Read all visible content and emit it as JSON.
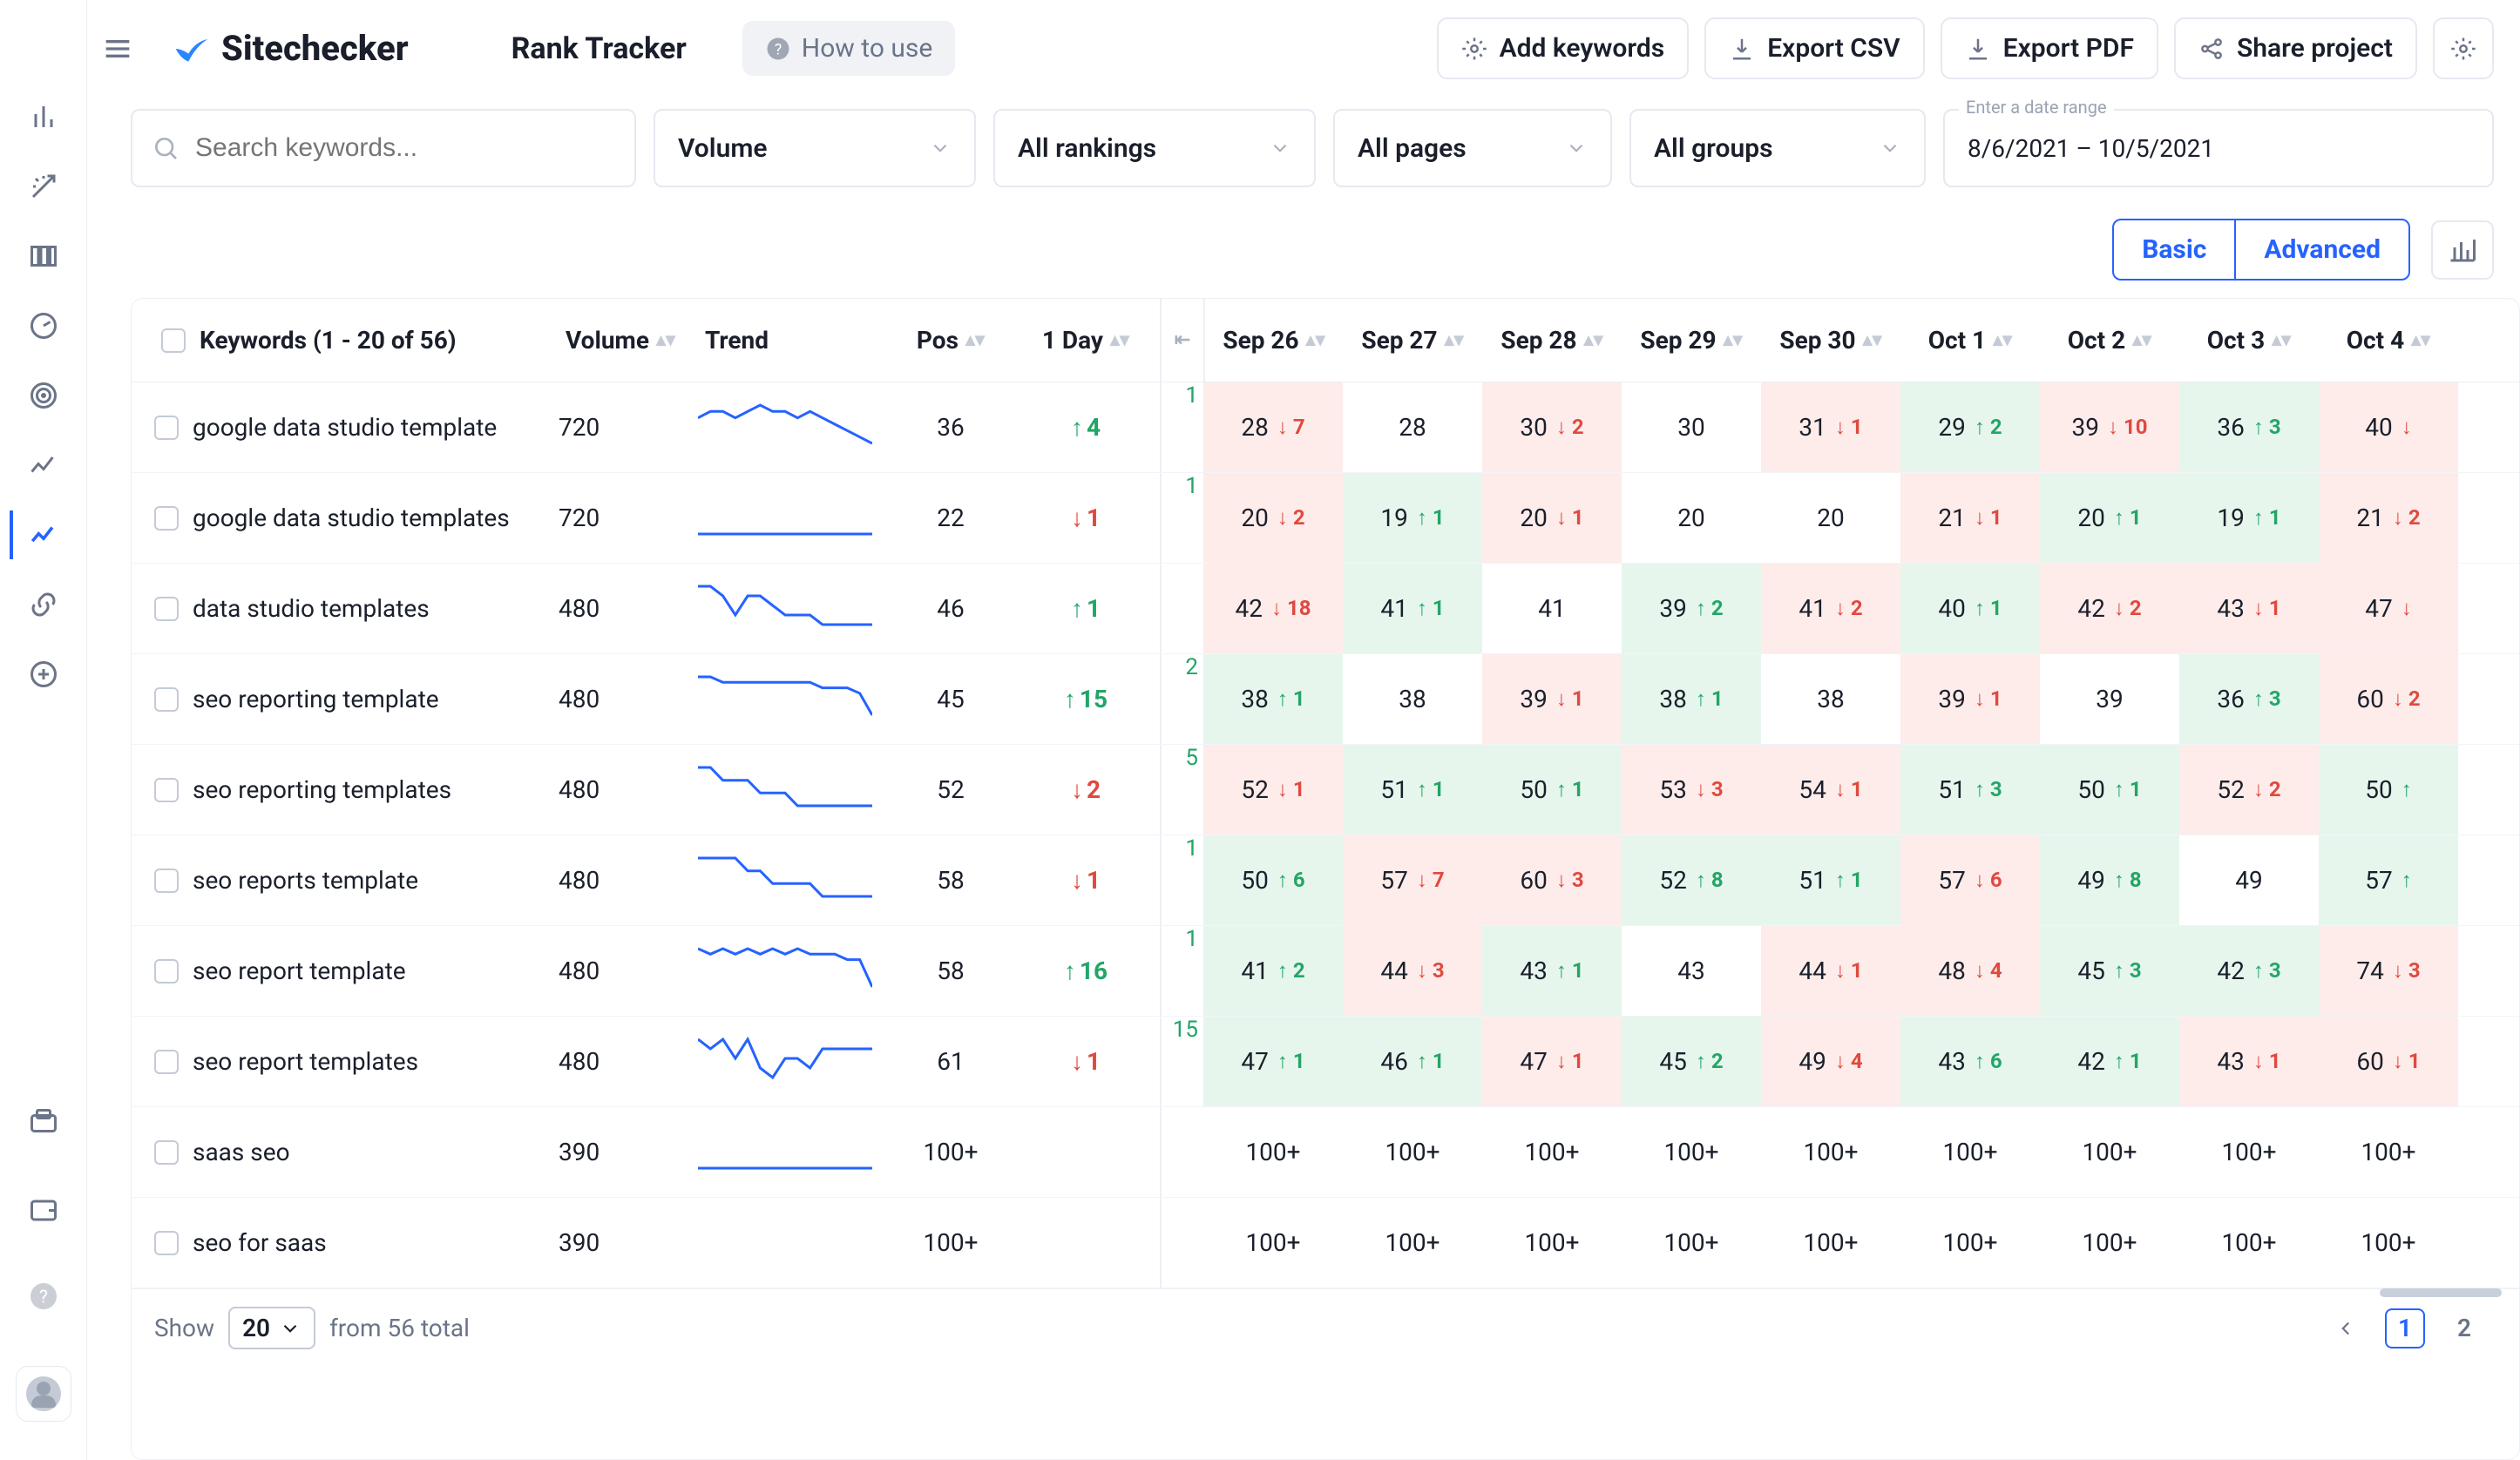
{
  "brand": {
    "name": "Sitechecker"
  },
  "page_title": "Rank Tracker",
  "how_to_use": "How to use",
  "header_buttons": {
    "add_keywords": "Add keywords",
    "export_csv": "Export CSV",
    "export_pdf": "Export PDF",
    "share_project": "Share project"
  },
  "filters": {
    "search_placeholder": "Search keywords...",
    "volume": "Volume",
    "rankings": "All rankings",
    "pages": "All pages",
    "groups": "All groups",
    "date_legend": "Enter a date range",
    "date_value": "8/6/2021 – 10/5/2021"
  },
  "mode_tabs": {
    "basic": "Basic",
    "advanced": "Advanced"
  },
  "columns": {
    "keywords_label": "Keywords (1 - 20 of 56)",
    "volume": "Volume",
    "trend": "Trend",
    "pos": "Pos",
    "one_day": "1 Day",
    "dates": [
      "Sep 26",
      "Sep 27",
      "Sep 28",
      "Sep 29",
      "Sep 30",
      "Oct 1",
      "Oct 2",
      "Oct 3",
      "Oct 4"
    ]
  },
  "rows": [
    {
      "keyword": "google data studio template",
      "volume": "720",
      "pos": "36",
      "one_day": {
        "dir": "up",
        "v": "4"
      },
      "spark": [
        8,
        9,
        9,
        8,
        9,
        10,
        9,
        9,
        8,
        9,
        8,
        7,
        6,
        5,
        4
      ],
      "edge": "1",
      "cells": [
        {
          "v": "28",
          "chg": {
            "dir": "down",
            "n": "7"
          }
        },
        {
          "v": "28"
        },
        {
          "v": "30",
          "chg": {
            "dir": "down",
            "n": "2"
          }
        },
        {
          "v": "30"
        },
        {
          "v": "31",
          "chg": {
            "dir": "down",
            "n": "1"
          }
        },
        {
          "v": "29",
          "chg": {
            "dir": "up",
            "n": "2"
          }
        },
        {
          "v": "39",
          "chg": {
            "dir": "down",
            "n": "10"
          }
        },
        {
          "v": "36",
          "chg": {
            "dir": "up",
            "n": "3"
          }
        },
        {
          "v": "40",
          "chg": {
            "dir": "down",
            "n": ""
          }
        }
      ]
    },
    {
      "keyword": "google data studio templates",
      "volume": "720",
      "pos": "22",
      "one_day": {
        "dir": "down",
        "v": "1"
      },
      "spark": [
        9,
        9,
        9,
        9,
        9,
        9,
        9,
        9,
        9,
        9,
        9,
        9,
        9,
        9,
        9
      ],
      "edge": "1",
      "cells": [
        {
          "v": "20",
          "chg": {
            "dir": "down",
            "n": "2"
          }
        },
        {
          "v": "19",
          "chg": {
            "dir": "up",
            "n": "1"
          }
        },
        {
          "v": "20",
          "chg": {
            "dir": "down",
            "n": "1"
          }
        },
        {
          "v": "20"
        },
        {
          "v": "20"
        },
        {
          "v": "21",
          "chg": {
            "dir": "down",
            "n": "1"
          }
        },
        {
          "v": "20",
          "chg": {
            "dir": "up",
            "n": "1"
          }
        },
        {
          "v": "19",
          "chg": {
            "dir": "up",
            "n": "1"
          }
        },
        {
          "v": "21",
          "chg": {
            "dir": "down",
            "n": "2"
          }
        }
      ]
    },
    {
      "keyword": "data studio templates",
      "volume": "480",
      "pos": "46",
      "one_day": {
        "dir": "up",
        "v": "1"
      },
      "spark": [
        9,
        9,
        8,
        6,
        8,
        8,
        7,
        6,
        6,
        6,
        5,
        5,
        5,
        5,
        5
      ],
      "edge": "",
      "cells": [
        {
          "v": "42",
          "chg": {
            "dir": "down",
            "n": "18"
          }
        },
        {
          "v": "41",
          "chg": {
            "dir": "up",
            "n": "1"
          }
        },
        {
          "v": "41"
        },
        {
          "v": "39",
          "chg": {
            "dir": "up",
            "n": "2"
          }
        },
        {
          "v": "41",
          "chg": {
            "dir": "down",
            "n": "2"
          }
        },
        {
          "v": "40",
          "chg": {
            "dir": "up",
            "n": "1"
          }
        },
        {
          "v": "42",
          "chg": {
            "dir": "down",
            "n": "2"
          }
        },
        {
          "v": "43",
          "chg": {
            "dir": "down",
            "n": "1"
          }
        },
        {
          "v": "47",
          "chg": {
            "dir": "down",
            "n": ""
          }
        }
      ]
    },
    {
      "keyword": "seo reporting template",
      "volume": "480",
      "pos": "45",
      "one_day": {
        "dir": "up",
        "v": "15"
      },
      "spark": [
        9,
        9,
        8,
        8,
        8,
        8,
        8,
        8,
        8,
        8,
        7,
        7,
        7,
        6,
        2
      ],
      "edge": "2",
      "cells": [
        {
          "v": "38",
          "chg": {
            "dir": "up",
            "n": "1"
          }
        },
        {
          "v": "38"
        },
        {
          "v": "39",
          "chg": {
            "dir": "down",
            "n": "1"
          }
        },
        {
          "v": "38",
          "chg": {
            "dir": "up",
            "n": "1"
          }
        },
        {
          "v": "38"
        },
        {
          "v": "39",
          "chg": {
            "dir": "down",
            "n": "1"
          }
        },
        {
          "v": "39"
        },
        {
          "v": "36",
          "chg": {
            "dir": "up",
            "n": "3"
          }
        },
        {
          "v": "60",
          "chg": {
            "dir": "down",
            "n": "2"
          }
        }
      ]
    },
    {
      "keyword": "seo reporting templates",
      "volume": "480",
      "pos": "52",
      "one_day": {
        "dir": "down",
        "v": "2"
      },
      "spark": [
        9,
        9,
        8,
        8,
        8,
        7,
        7,
        7,
        6,
        6,
        6,
        6,
        6,
        6,
        6
      ],
      "edge": "5",
      "cells": [
        {
          "v": "52",
          "chg": {
            "dir": "down",
            "n": "1"
          }
        },
        {
          "v": "51",
          "chg": {
            "dir": "up",
            "n": "1"
          }
        },
        {
          "v": "50",
          "chg": {
            "dir": "up",
            "n": "1"
          }
        },
        {
          "v": "53",
          "chg": {
            "dir": "down",
            "n": "3"
          }
        },
        {
          "v": "54",
          "chg": {
            "dir": "down",
            "n": "1"
          }
        },
        {
          "v": "51",
          "chg": {
            "dir": "up",
            "n": "3"
          }
        },
        {
          "v": "50",
          "chg": {
            "dir": "up",
            "n": "1"
          }
        },
        {
          "v": "52",
          "chg": {
            "dir": "down",
            "n": "2"
          }
        },
        {
          "v": "50",
          "chg": {
            "dir": "up",
            "n": ""
          }
        }
      ]
    },
    {
      "keyword": "seo reports template",
      "volume": "480",
      "pos": "58",
      "one_day": {
        "dir": "down",
        "v": "1"
      },
      "spark": [
        8,
        8,
        8,
        8,
        7,
        7,
        6,
        6,
        6,
        6,
        5,
        5,
        5,
        5,
        5
      ],
      "edge": "1",
      "cells": [
        {
          "v": "50",
          "chg": {
            "dir": "up",
            "n": "6"
          }
        },
        {
          "v": "57",
          "chg": {
            "dir": "down",
            "n": "7"
          }
        },
        {
          "v": "60",
          "chg": {
            "dir": "down",
            "n": "3"
          }
        },
        {
          "v": "52",
          "chg": {
            "dir": "up",
            "n": "8"
          }
        },
        {
          "v": "51",
          "chg": {
            "dir": "up",
            "n": "1"
          }
        },
        {
          "v": "57",
          "chg": {
            "dir": "down",
            "n": "6"
          }
        },
        {
          "v": "49",
          "chg": {
            "dir": "up",
            "n": "8"
          }
        },
        {
          "v": "49"
        },
        {
          "v": "57",
          "chg": {
            "dir": "up",
            "n": ""
          }
        }
      ]
    },
    {
      "keyword": "seo report template",
      "volume": "480",
      "pos": "58",
      "one_day": {
        "dir": "up",
        "v": "16"
      },
      "spark": [
        9,
        8,
        9,
        8,
        9,
        8,
        9,
        8,
        9,
        8,
        8,
        8,
        7,
        7,
        2
      ],
      "edge": "1",
      "cells": [
        {
          "v": "41",
          "chg": {
            "dir": "up",
            "n": "2"
          }
        },
        {
          "v": "44",
          "chg": {
            "dir": "down",
            "n": "3"
          }
        },
        {
          "v": "43",
          "chg": {
            "dir": "up",
            "n": "1"
          }
        },
        {
          "v": "43"
        },
        {
          "v": "44",
          "chg": {
            "dir": "down",
            "n": "1"
          }
        },
        {
          "v": "48",
          "chg": {
            "dir": "down",
            "n": "4"
          }
        },
        {
          "v": "45",
          "chg": {
            "dir": "up",
            "n": "3"
          }
        },
        {
          "v": "42",
          "chg": {
            "dir": "up",
            "n": "3"
          }
        },
        {
          "v": "74",
          "chg": {
            "dir": "down",
            "n": "3"
          }
        }
      ]
    },
    {
      "keyword": "seo report templates",
      "volume": "480",
      "pos": "61",
      "one_day": {
        "dir": "down",
        "v": "1"
      },
      "spark": [
        9,
        8,
        9,
        7,
        9,
        6,
        5,
        7,
        7,
        6,
        8,
        8,
        8,
        8,
        8
      ],
      "edge": "15",
      "cells": [
        {
          "v": "47",
          "chg": {
            "dir": "up",
            "n": "1"
          }
        },
        {
          "v": "46",
          "chg": {
            "dir": "up",
            "n": "1"
          }
        },
        {
          "v": "47",
          "chg": {
            "dir": "down",
            "n": "1"
          }
        },
        {
          "v": "45",
          "chg": {
            "dir": "up",
            "n": "2"
          }
        },
        {
          "v": "49",
          "chg": {
            "dir": "down",
            "n": "4"
          }
        },
        {
          "v": "43",
          "chg": {
            "dir": "up",
            "n": "6"
          }
        },
        {
          "v": "42",
          "chg": {
            "dir": "up",
            "n": "1"
          }
        },
        {
          "v": "43",
          "chg": {
            "dir": "down",
            "n": "1"
          }
        },
        {
          "v": "60",
          "chg": {
            "dir": "down",
            "n": "1"
          }
        }
      ]
    },
    {
      "keyword": "saas seo",
      "volume": "390",
      "pos": "100+",
      "one_day": null,
      "spark": [
        1,
        1,
        1,
        1,
        1,
        1,
        1,
        1,
        1,
        1,
        1,
        1,
        1,
        1,
        1
      ],
      "edge": "",
      "cells": [
        {
          "v": "100+"
        },
        {
          "v": "100+"
        },
        {
          "v": "100+"
        },
        {
          "v": "100+"
        },
        {
          "v": "100+"
        },
        {
          "v": "100+"
        },
        {
          "v": "100+"
        },
        {
          "v": "100+"
        },
        {
          "v": "100+"
        }
      ]
    },
    {
      "keyword": "seo for saas",
      "volume": "390",
      "pos": "100+",
      "one_day": null,
      "spark": null,
      "edge": "",
      "cells": [
        {
          "v": "100+"
        },
        {
          "v": "100+"
        },
        {
          "v": "100+"
        },
        {
          "v": "100+"
        },
        {
          "v": "100+"
        },
        {
          "v": "100+"
        },
        {
          "v": "100+"
        },
        {
          "v": "100+"
        },
        {
          "v": "100+"
        }
      ]
    }
  ],
  "footer": {
    "show_label": "Show",
    "page_size": "20",
    "total_label": "from 56 total",
    "pages": [
      "1",
      "2"
    ],
    "active_page": 0
  },
  "colors": {
    "accent": "#2563ff",
    "up": "#23a566",
    "down": "#e0493e",
    "up_bg": "#e6f6ed",
    "down_bg": "#fdecea"
  }
}
